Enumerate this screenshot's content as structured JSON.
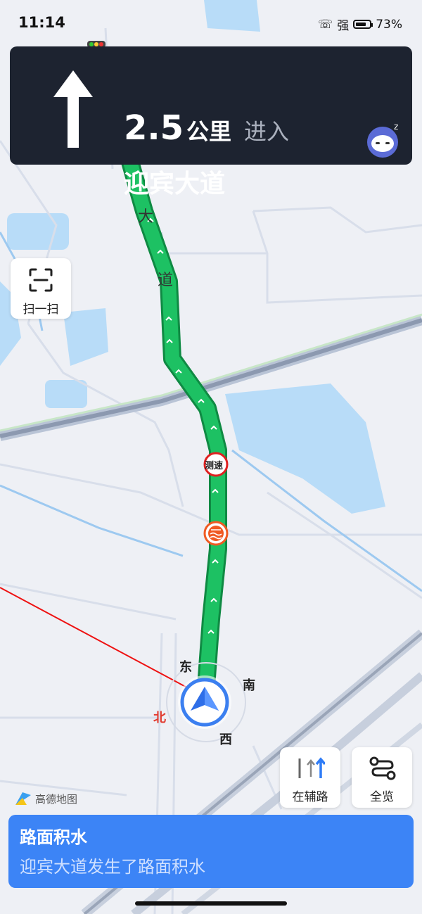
{
  "status_bar": {
    "time": "11:14",
    "signal": "强",
    "battery": "73%"
  },
  "navigation": {
    "distance": "2.5",
    "unit": "公里",
    "action": "进入",
    "road": "迎宾大道"
  },
  "map": {
    "road_labels": [
      "大",
      "道"
    ],
    "speed_camera": "测速",
    "compass": {
      "east": "东",
      "south": "南",
      "north": "北",
      "west": "西"
    },
    "route_color": "#18b15a",
    "water_color": "#b8dcf8"
  },
  "buttons": {
    "scan": "扫一扫",
    "aux_road": "在辅路",
    "overview": "全览"
  },
  "logo": "高德地图",
  "alert": {
    "title": "路面积水",
    "message": "迎宾大道发生了路面积水"
  }
}
